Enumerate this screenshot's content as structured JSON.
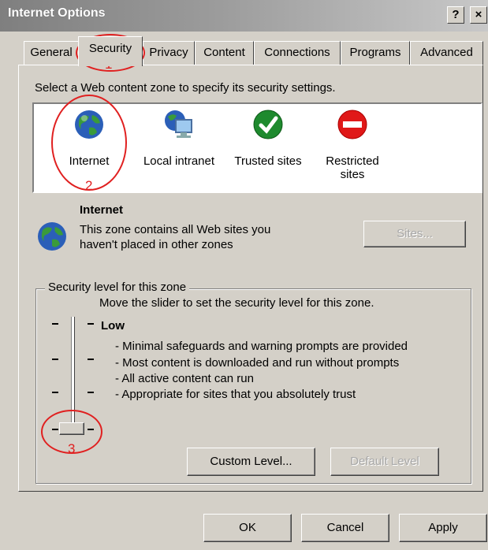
{
  "window": {
    "title": "Internet Options",
    "help_label": "?",
    "close_label": "×"
  },
  "tabs": [
    {
      "label": "General"
    },
    {
      "label": "Security"
    },
    {
      "label": "Privacy"
    },
    {
      "label": "Content"
    },
    {
      "label": "Connections"
    },
    {
      "label": "Programs"
    },
    {
      "label": "Advanced"
    }
  ],
  "security": {
    "instruction": "Select a Web content zone to specify its security settings.",
    "zones": [
      {
        "label": "Internet",
        "icon": "globe-icon"
      },
      {
        "label": "Local intranet",
        "icon": "intranet-icon"
      },
      {
        "label": "Trusted sites",
        "icon": "checkmark-icon"
      },
      {
        "label": "Restricted",
        "label2": "sites",
        "icon": "restricted-icon"
      }
    ],
    "selected_zone": {
      "name": "Internet",
      "description_line1": "This zone contains all Web sites you",
      "description_line2": "haven't placed in other zones"
    },
    "sites_button": "Sites...",
    "level_group": {
      "legend": "Security level for this zone",
      "instruction": "Move the slider to set the security level for this zone.",
      "level_name": "Low",
      "bullets": [
        "- Minimal safeguards and warning prompts are provided",
        "- Most content is downloaded and run without prompts",
        "- All active content can run",
        "- Appropriate for sites that you absolutely trust"
      ],
      "slider_level": "Low",
      "custom_level_button": "Custom Level...",
      "default_level_button": "Default Level"
    }
  },
  "annotations": {
    "n1": "1",
    "n2": "2",
    "n3": "3"
  },
  "footer": {
    "ok": "OK",
    "cancel": "Cancel",
    "apply": "Apply"
  },
  "colors": {
    "dialog_bg": "#d4d0c8",
    "annotation_red": "#e02020"
  }
}
